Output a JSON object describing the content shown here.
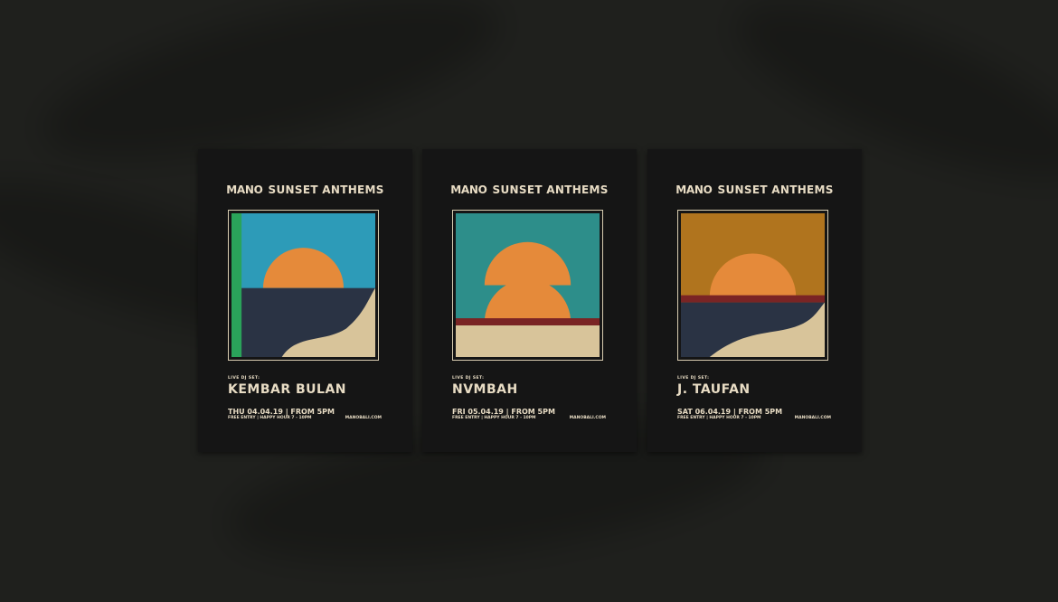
{
  "posters": [
    {
      "brand": "MANO",
      "series": "SUNSET ANTHEMS",
      "live_label": "LIVE DJ SET:",
      "artist": "KEMBAR BULAN",
      "date": "THU 04.04.19 | FROM 5PM",
      "entry": "FREE ENTRY | HAPPY HOUR 7 - 10PM",
      "website": "MANOBALI.COM"
    },
    {
      "brand": "MANO",
      "series": "SUNSET ANTHEMS",
      "live_label": "LIVE DJ SET:",
      "artist": "NVMBAH",
      "date": "FRI 05.04.19 | FROM 5PM",
      "entry": "FREE ENTRY | HAPPY HOUR 7 - 10PM",
      "website": "MANOBALI.COM"
    },
    {
      "brand": "MANO",
      "series": "SUNSET ANTHEMS",
      "live_label": "LIVE DJ SET:",
      "artist": "J. TAUFAN",
      "date": "SAT 06.04.19 | FROM 5PM",
      "entry": "FREE ENTRY | HAPPY HOUR 7 - 10PM",
      "website": "MANOBALI.COM"
    }
  ],
  "colors": {
    "background": "#1f201d",
    "poster": "#151515",
    "text": "#e8dcc4",
    "sun": "#e58a3a",
    "sky_blue": "#2d9bb8",
    "sky_teal": "#2d8e8a",
    "sky_ochre": "#b0741e",
    "sea": "#2a3344",
    "sand": "#d8c49a",
    "stripe_red": "#7a2424",
    "stripe_green": "#2aa35a"
  }
}
